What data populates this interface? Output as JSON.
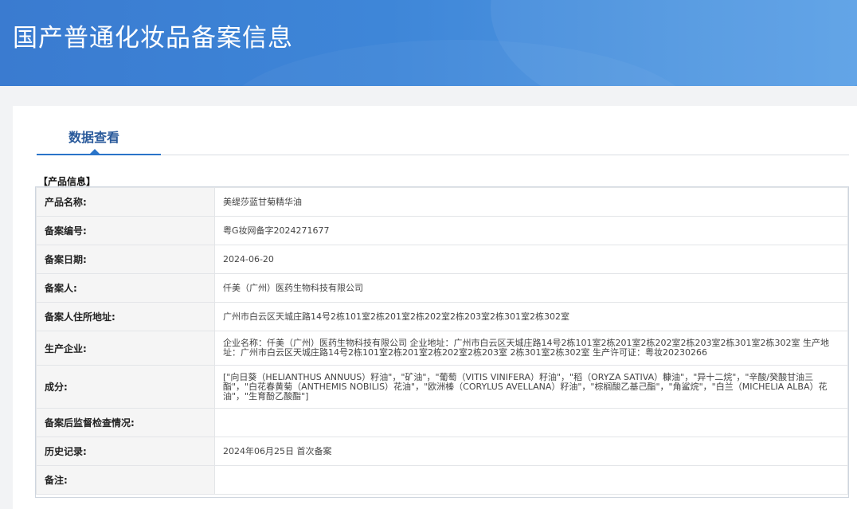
{
  "header": {
    "title": "国产普通化妆品备案信息"
  },
  "tab": {
    "label": "数据查看"
  },
  "section": {
    "title": "【产品信息】"
  },
  "rows": [
    {
      "label": "产品名称:",
      "value": "美缇莎蓝甘菊精华油"
    },
    {
      "label": "备案编号:",
      "value": "粤G妆网备字2024271677"
    },
    {
      "label": "备案日期:",
      "value": "2024-06-20"
    },
    {
      "label": "备案人:",
      "value": "仟美（广州）医药生物科技有限公司"
    },
    {
      "label": "备案人住所地址:",
      "value": "广州市白云区天城庄路14号2栋101室2栋201室2栋202室2栋203室2栋301室2栋302室"
    },
    {
      "label": "生产企业:",
      "value": "企业名称：仟美（广州）医药生物科技有限公司 企业地址：广州市白云区天城庄路14号2栋101室2栋201室2栋202室2栋203室2栋301室2栋302室 生产地址：广州市白云区天城庄路14号2栋101室2栋201室2栋202室2栋203室 2栋301室2栋302室 生产许可证：粤妆20230266"
    },
    {
      "label": "成分:",
      "value": "[\"向日葵（HELIANTHUS ANNUUS）籽油\"，\"矿油\"，\"葡萄（VITIS VINIFERA）籽油\"，\"稻（ORYZA SATIVA）糠油\"，\"异十二烷\"，\"辛酸/癸酸甘油三酯\"，\"白花春黄菊（ANTHEMIS NOBILIS）花油\"，\"欧洲榛（CORYLUS AVELLANA）籽油\"，\"棕榈酸乙基己酯\"，\"角鲨烷\"，\"白兰（MICHELIA ALBA）花油\"，\"生育酚乙酸酯\"]"
    },
    {
      "label": "备案后监督检查情况:",
      "value": ""
    },
    {
      "label": "历史记录:",
      "value": "2024年06月25日 首次备案"
    },
    {
      "label": "备注:",
      "value": ""
    }
  ]
}
